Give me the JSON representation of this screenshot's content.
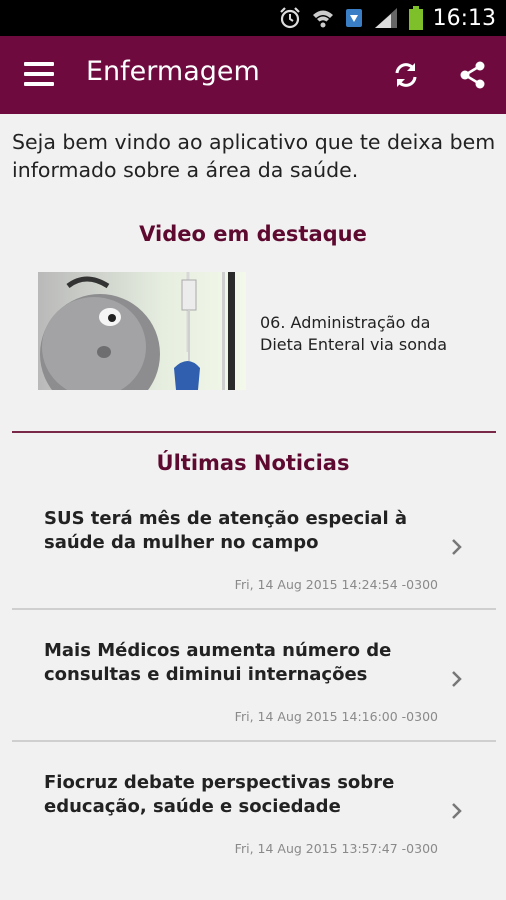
{
  "status_bar": {
    "time": "16:13"
  },
  "app_bar": {
    "title": "Enfermagem"
  },
  "intro": "Seja bem vindo ao aplicativo que te deixa bem informado sobre a área da saúde.",
  "featured": {
    "heading": "Video em destaque",
    "video_caption": "06. Administração da Dieta Enteral via sonda"
  },
  "news": {
    "heading": "Últimas Noticias",
    "items": [
      {
        "headline": "SUS terá mês de atenção especial à saúde da mulher no campo",
        "date": "Fri, 14 Aug 2015 14:24:54 -0300"
      },
      {
        "headline": "Mais Médicos aumenta número de consultas e diminui internações",
        "date": "Fri, 14 Aug 2015 14:16:00 -0300"
      },
      {
        "headline": "Fiocruz debate perspectivas sobre educação, saúde e sociedade",
        "date": "Fri, 14 Aug 2015 13:57:47 -0300"
      }
    ]
  },
  "colors": {
    "primary": "#6e0a3e",
    "heading": "#5e0a30",
    "battery": "#7dc02a"
  },
  "icons": [
    "alarm-icon",
    "wifi-icon",
    "notification-icon",
    "signal-icon",
    "battery-icon",
    "menu-icon",
    "refresh-icon",
    "share-icon",
    "chevron-right-icon"
  ]
}
